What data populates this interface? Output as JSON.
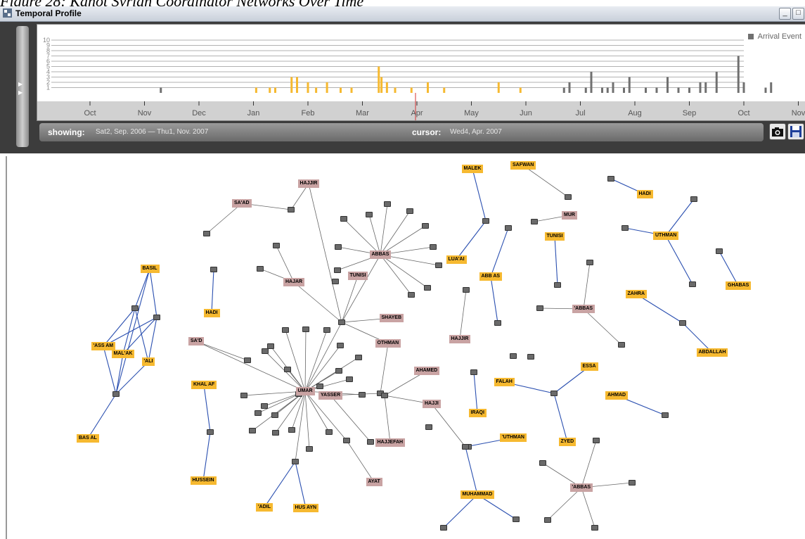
{
  "caption": "Figure 28: Kanot Syrian Coordinator Networks Over Time",
  "window": {
    "title": "Temporal Profile",
    "minimize_label": "_",
    "restore_label": "□"
  },
  "legend": {
    "label": "Arrival Event"
  },
  "status": {
    "showing_label": "showing:",
    "showing_value": "Sat2, Sep. 2006 — Thu1, Nov. 2007",
    "cursor_label": "cursor:",
    "cursor_value": "Wed4, Apr. 2007"
  },
  "colors": {
    "orange": "#f6b930",
    "gray": "#707070",
    "cursor": "#d33333",
    "edge_blue": "#2a4fb0",
    "edge_gray": "#666666"
  },
  "chart_data": {
    "type": "bar",
    "x_labels": [
      "Oct",
      "Nov",
      "Dec",
      "Jan",
      "Feb",
      "Mar",
      "Apr",
      "May",
      "Jun",
      "Jul",
      "Aug",
      "Sep",
      "Oct",
      "Nov"
    ],
    "y_tick_labels": [
      "1",
      "2",
      "3",
      "4",
      "5",
      "6",
      "7",
      "8",
      "9",
      "10"
    ],
    "ylim": [
      0,
      10
    ],
    "cursor_month_index": 6.0,
    "series": [
      {
        "name": "Arrival Event",
        "color": "#707070",
        "bars": [
          [
            1.3,
            1
          ],
          [
            8.7,
            1
          ],
          [
            8.8,
            2
          ],
          [
            9.1,
            1
          ],
          [
            9.2,
            4
          ],
          [
            9.4,
            1
          ],
          [
            9.5,
            1
          ],
          [
            9.6,
            2
          ],
          [
            9.8,
            1
          ],
          [
            9.9,
            3
          ],
          [
            10.2,
            1
          ],
          [
            10.4,
            1
          ],
          [
            10.6,
            3
          ],
          [
            10.8,
            1
          ],
          [
            11.0,
            1
          ],
          [
            11.2,
            2
          ],
          [
            11.3,
            2
          ],
          [
            11.5,
            4
          ],
          [
            11.9,
            7
          ],
          [
            12.0,
            2
          ],
          [
            12.4,
            1
          ],
          [
            12.5,
            2
          ]
        ]
      },
      {
        "name": "orange",
        "color": "#f6b930",
        "bars": [
          [
            3.05,
            1
          ],
          [
            3.3,
            1
          ],
          [
            3.4,
            1
          ],
          [
            3.7,
            3
          ],
          [
            3.8,
            3
          ],
          [
            4.0,
            2
          ],
          [
            4.15,
            1
          ],
          [
            4.35,
            2
          ],
          [
            4.6,
            1
          ],
          [
            4.8,
            1
          ],
          [
            5.3,
            5
          ],
          [
            5.35,
            3
          ],
          [
            5.45,
            2
          ],
          [
            5.6,
            1
          ],
          [
            5.9,
            1
          ],
          [
            6.2,
            2
          ],
          [
            6.5,
            1
          ],
          [
            7.5,
            2
          ],
          [
            7.9,
            1
          ]
        ]
      }
    ]
  },
  "graph": {
    "nodes": [
      {
        "id": "hajjir1",
        "label": "HAJJIR",
        "kind": "pink"
      },
      {
        "id": "saad1",
        "label": "SA'AD",
        "kind": "pink"
      },
      {
        "id": "abbas1",
        "label": "ABBAS",
        "kind": "pink"
      },
      {
        "id": "tunisi1",
        "label": "TUNISI",
        "kind": "pink"
      },
      {
        "id": "hajar1",
        "label": "HAJAR",
        "kind": "pink"
      },
      {
        "id": "shayeb",
        "label": "SHAYEB",
        "kind": "pink"
      },
      {
        "id": "othman",
        "label": "OTHMAN",
        "kind": "pink"
      },
      {
        "id": "sad2",
        "label": "SA'D",
        "kind": "pink"
      },
      {
        "id": "umar",
        "label": "UMAR",
        "kind": "pink"
      },
      {
        "id": "yasser",
        "label": "YASSER",
        "kind": "pink"
      },
      {
        "id": "ahamed",
        "label": "AHAMED",
        "kind": "pink"
      },
      {
        "id": "hajji",
        "label": "HAJJI",
        "kind": "pink"
      },
      {
        "id": "hajjir2",
        "label": "HAJJIR",
        "kind": "pink"
      },
      {
        "id": "hajjefah",
        "label": "HAJJEFAH",
        "kind": "pink"
      },
      {
        "id": "ayat",
        "label": "AYAT",
        "kind": "pink"
      },
      {
        "id": "mur",
        "label": "MUR",
        "kind": "pink"
      },
      {
        "id": "abbas2",
        "label": "'ABBAS",
        "kind": "pink"
      },
      {
        "id": "abbas3",
        "label": "'ABBAS",
        "kind": "pink"
      },
      {
        "id": "basil",
        "label": "BASIL",
        "kind": "orange"
      },
      {
        "id": "assam",
        "label": "'ASS AM",
        "kind": "orange"
      },
      {
        "id": "malak",
        "label": "MAL'AK",
        "kind": "orange"
      },
      {
        "id": "ali",
        "label": "'ALI",
        "kind": "orange"
      },
      {
        "id": "basal",
        "label": "BAS AL",
        "kind": "orange"
      },
      {
        "id": "hadi1",
        "label": "HADI",
        "kind": "orange"
      },
      {
        "id": "khalaf",
        "label": "KHAL AF",
        "kind": "orange"
      },
      {
        "id": "hussein",
        "label": "HUSSEIN",
        "kind": "orange"
      },
      {
        "id": "adil",
        "label": "'ADIL",
        "kind": "orange"
      },
      {
        "id": "husayn",
        "label": "HUS AYN",
        "kind": "orange"
      },
      {
        "id": "malek",
        "label": "MALEK",
        "kind": "orange"
      },
      {
        "id": "luaai",
        "label": "LUA'AI",
        "kind": "orange"
      },
      {
        "id": "safwan",
        "label": "SAFWAN",
        "kind": "orange"
      },
      {
        "id": "tunisi2",
        "label": "TUNISI",
        "kind": "orange"
      },
      {
        "id": "abbas4",
        "label": "ABB AS",
        "kind": "orange"
      },
      {
        "id": "hadi2",
        "label": "HADI",
        "kind": "orange"
      },
      {
        "id": "uthman1",
        "label": "UTHMAN",
        "kind": "orange"
      },
      {
        "id": "ghabas",
        "label": "GHABAS",
        "kind": "orange"
      },
      {
        "id": "zahra",
        "label": "ZAHRA",
        "kind": "orange"
      },
      {
        "id": "abdallah",
        "label": "ABDALLAH",
        "kind": "orange"
      },
      {
        "id": "essa",
        "label": "ESSA",
        "kind": "orange"
      },
      {
        "id": "falah",
        "label": "FALAH",
        "kind": "orange"
      },
      {
        "id": "ahmad",
        "label": "AHMAD",
        "kind": "orange"
      },
      {
        "id": "iraqi",
        "label": "IRAQI",
        "kind": "orange"
      },
      {
        "id": "zyed",
        "label": "ZYED",
        "kind": "orange"
      },
      {
        "id": "uthman2",
        "label": "'UTHMAN",
        "kind": "orange"
      },
      {
        "id": "muhammad",
        "label": "MUHAMMAD",
        "kind": "orange"
      }
    ]
  }
}
